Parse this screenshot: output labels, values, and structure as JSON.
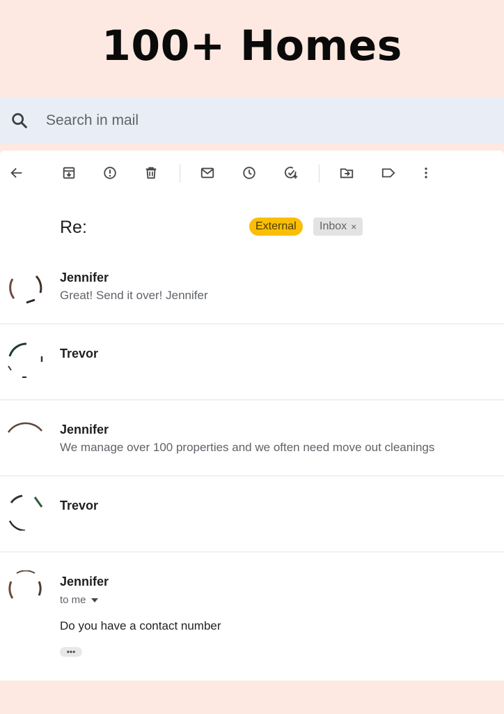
{
  "headline": "100+ Homes",
  "search": {
    "placeholder": "Search in mail"
  },
  "toolbar": {
    "icons": [
      "back-arrow-icon",
      "archive-icon",
      "report-spam-icon",
      "delete-icon",
      "mark-unread-icon",
      "snooze-icon",
      "add-task-icon",
      "move-to-icon",
      "label-icon",
      "more-vert-icon"
    ]
  },
  "thread": {
    "subject": "Re:",
    "labels": {
      "external": "External",
      "inbox": "Inbox",
      "inbox_remove": "×"
    }
  },
  "messages": [
    {
      "sender": "Jennifer",
      "snippet": "Great! Send it over! Jennifer"
    },
    {
      "sender": "Trevor",
      "snippet": ""
    },
    {
      "sender": "Jennifer",
      "snippet": "We manage over 100 properties and we often need move out cleanings"
    },
    {
      "sender": "Trevor",
      "snippet": ""
    },
    {
      "sender": "Jennifer",
      "to": "to me",
      "body": "Do you have a contact number",
      "more": "•••"
    }
  ],
  "colors": {
    "background": "#fde9e1",
    "search_bg": "#e9eef6",
    "external_chip": "#f9be05",
    "inbox_chip": "#e3e3e3"
  }
}
